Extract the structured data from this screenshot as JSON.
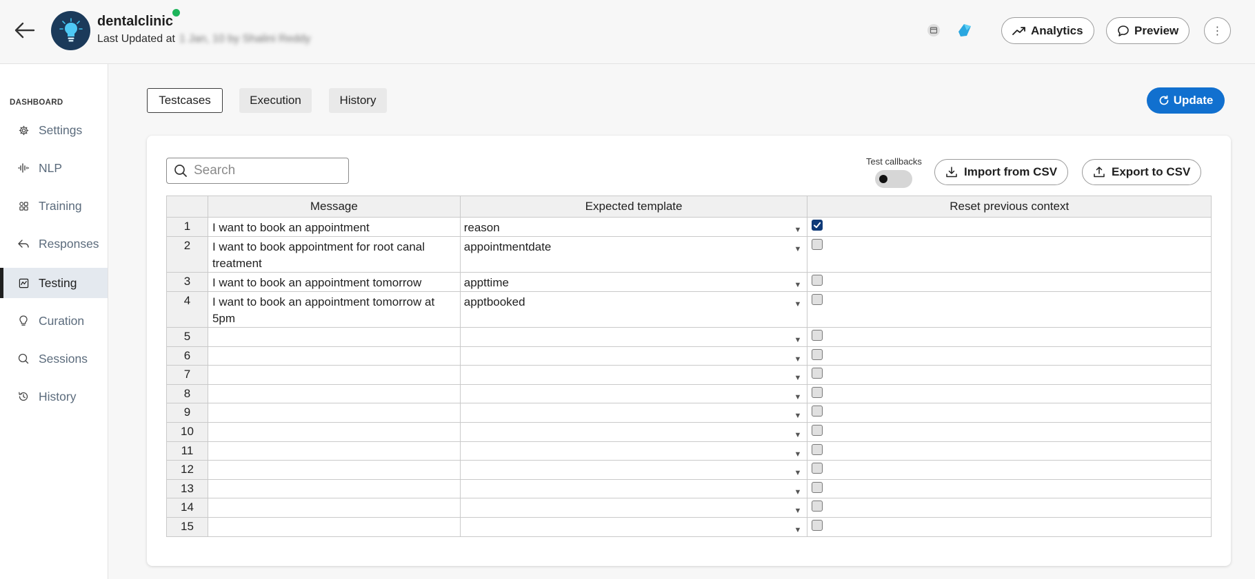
{
  "header": {
    "bot_name": "dentalclinic",
    "last_updated_label": "Last Updated at",
    "last_updated_value": "1 Jan, 10 by Shalini Reddy",
    "analytics_label": "Analytics",
    "preview_label": "Preview"
  },
  "sidebar": {
    "section_label": "DASHBOARD",
    "items": [
      {
        "label": "Settings",
        "icon": "gear-icon"
      },
      {
        "label": "NLP",
        "icon": "waveform-icon"
      },
      {
        "label": "Training",
        "icon": "training-icon"
      },
      {
        "label": "Responses",
        "icon": "reply-icon"
      },
      {
        "label": "Testing",
        "icon": "testing-icon",
        "active": true
      },
      {
        "label": "Curation",
        "icon": "lightbulb-icon"
      },
      {
        "label": "Sessions",
        "icon": "chat-search-icon"
      },
      {
        "label": "History",
        "icon": "history-icon"
      }
    ]
  },
  "tabs": [
    {
      "label": "Testcases",
      "active": true
    },
    {
      "label": "Execution"
    },
    {
      "label": "History"
    }
  ],
  "update_label": "Update",
  "toolbar": {
    "search_placeholder": "Search",
    "test_callbacks_label": "Test callbacks",
    "test_callbacks_on": false,
    "import_label": "Import from CSV",
    "export_label": "Export to CSV"
  },
  "table": {
    "columns": [
      "",
      "Message",
      "Expected template",
      "Reset previous context"
    ],
    "rows": [
      {
        "n": "1",
        "message": "I want to book an appointment",
        "template": "reason",
        "reset": true
      },
      {
        "n": "2",
        "message": "I want to book appointment for root canal treatment",
        "template": "appointmentdate",
        "reset": false
      },
      {
        "n": "3",
        "message": "I want to book an appointment tomorrow",
        "template": "appttime",
        "reset": false
      },
      {
        "n": "4",
        "message": "I want to book an appointment tomorrow at 5pm",
        "template": "apptbooked",
        "reset": false
      },
      {
        "n": "5",
        "message": "",
        "template": "",
        "reset": false
      },
      {
        "n": "6",
        "message": "",
        "template": "",
        "reset": false
      },
      {
        "n": "7",
        "message": "",
        "template": "",
        "reset": false
      },
      {
        "n": "8",
        "message": "",
        "template": "",
        "reset": false
      },
      {
        "n": "9",
        "message": "",
        "template": "",
        "reset": false
      },
      {
        "n": "10",
        "message": "",
        "template": "",
        "reset": false
      },
      {
        "n": "11",
        "message": "",
        "template": "",
        "reset": false
      },
      {
        "n": "12",
        "message": "",
        "template": "",
        "reset": false
      },
      {
        "n": "13",
        "message": "",
        "template": "",
        "reset": false
      },
      {
        "n": "14",
        "message": "",
        "template": "",
        "reset": false
      },
      {
        "n": "15",
        "message": "",
        "template": "",
        "reset": false
      }
    ]
  },
  "colors": {
    "accent": "#1170cf",
    "checkbox_checked": "#0f3a78",
    "online_dot": "#1db45a",
    "avatar_bg": "#1b3a5a"
  }
}
